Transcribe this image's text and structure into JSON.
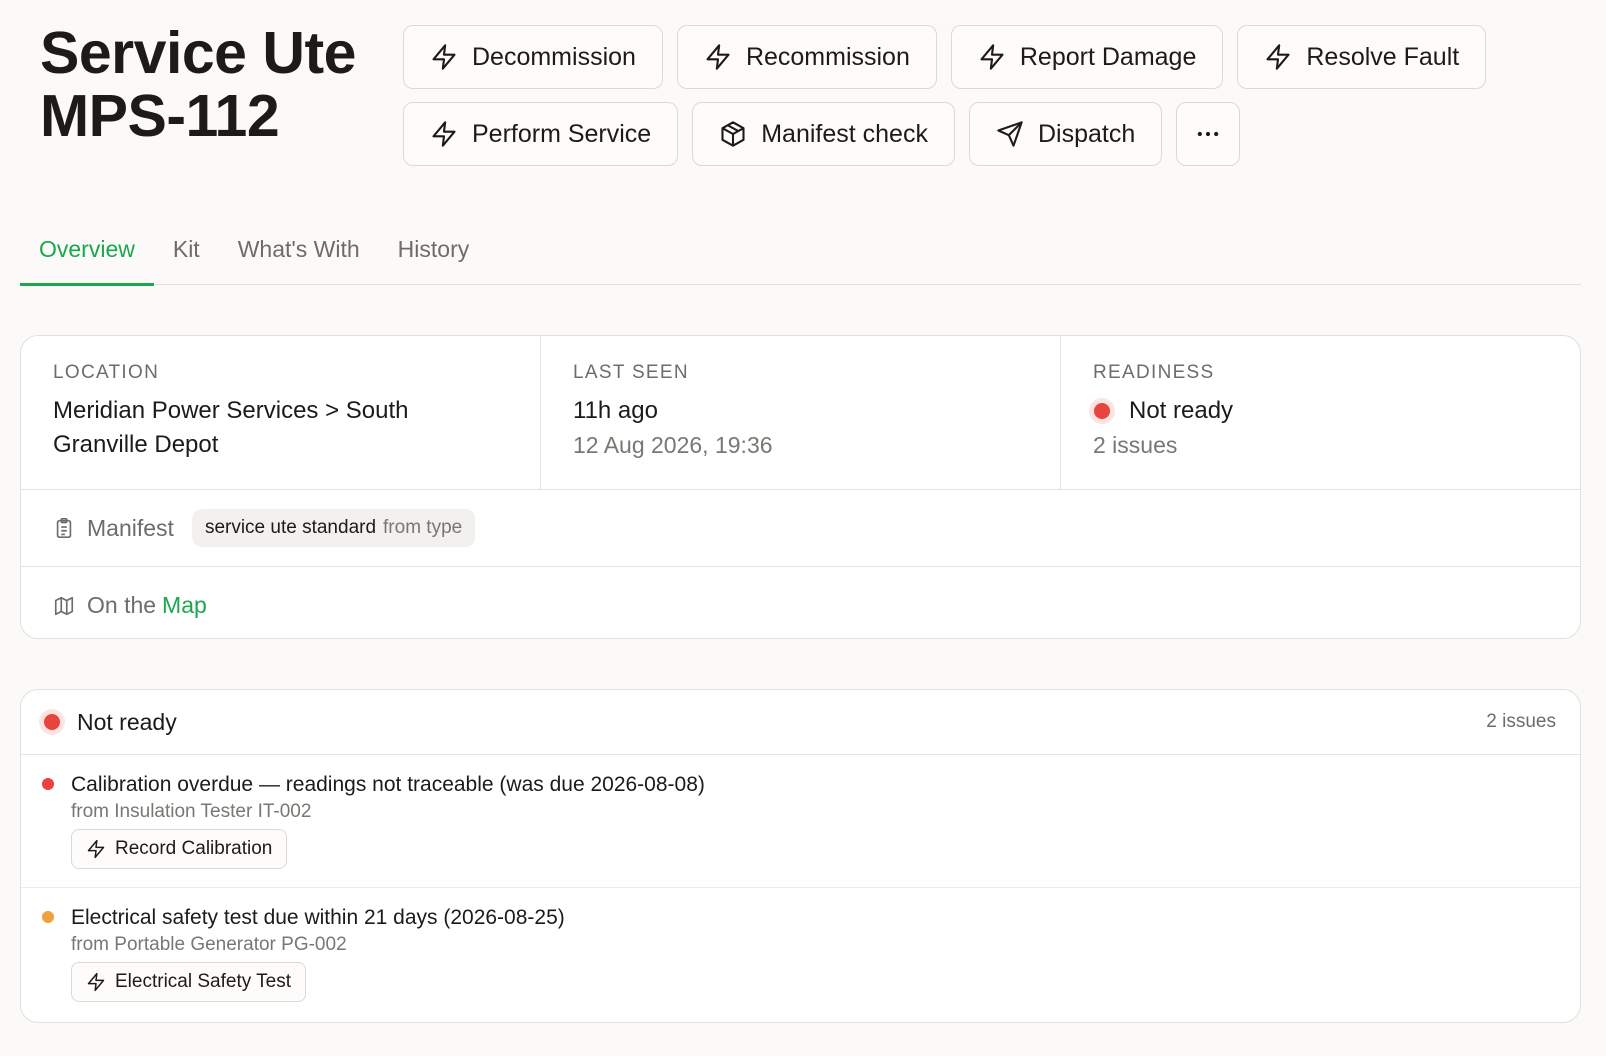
{
  "asset": {
    "title_line1": "Service Ute",
    "title_line2": "MPS-112"
  },
  "actions": {
    "row1": [
      {
        "label": "Decommission",
        "icon": "bolt-icon"
      },
      {
        "label": "Recommission",
        "icon": "bolt-icon"
      },
      {
        "label": "Report Damage",
        "icon": "bolt-icon"
      },
      {
        "label": "Resolve Fault",
        "icon": "bolt-icon"
      }
    ],
    "row2": [
      {
        "label": "Perform Service",
        "icon": "bolt-icon"
      },
      {
        "label": "Manifest check",
        "icon": "package-icon"
      },
      {
        "label": "Dispatch",
        "icon": "send-icon"
      }
    ],
    "more_icon": "more-horizontal-icon"
  },
  "tabs": [
    {
      "label": "Overview",
      "active": true
    },
    {
      "label": "Kit",
      "active": false
    },
    {
      "label": "What's With",
      "active": false
    },
    {
      "label": "History",
      "active": false
    }
  ],
  "info": {
    "location": {
      "label": "LOCATION",
      "line1": "Meridian Power Services > South",
      "line2": "Granville Depot"
    },
    "last_seen": {
      "label": "LAST SEEN",
      "relative": "11h ago",
      "timestamp": "12 Aug 2026, 19:36"
    },
    "readiness": {
      "label": "READINESS",
      "status": "Not ready",
      "issues": "2 issues",
      "status_color": "#e8433d"
    },
    "manifest": {
      "label": "Manifest",
      "chip_name": "service ute standard",
      "chip_source": "from type",
      "icon": "clipboard-icon"
    },
    "map": {
      "prefix": "On the",
      "link": "Map",
      "icon": "map-icon"
    }
  },
  "issues_panel": {
    "status": "Not ready",
    "count": "2 issues",
    "items": [
      {
        "title": "Calibration overdue — readings not traceable (was due 2026-08-08)",
        "from": "from Insulation Tester IT-002",
        "action": "Record Calibration",
        "severity_color": "#e8433d"
      },
      {
        "title": "Electrical safety test due within 21 days (2026-08-25)",
        "from": "from Portable Generator PG-002",
        "action": "Electrical Safety Test",
        "severity_color": "#f0a03c"
      }
    ]
  },
  "colors": {
    "accent": "#1aa84c",
    "danger": "#e8433d",
    "warning": "#f0a03c"
  }
}
